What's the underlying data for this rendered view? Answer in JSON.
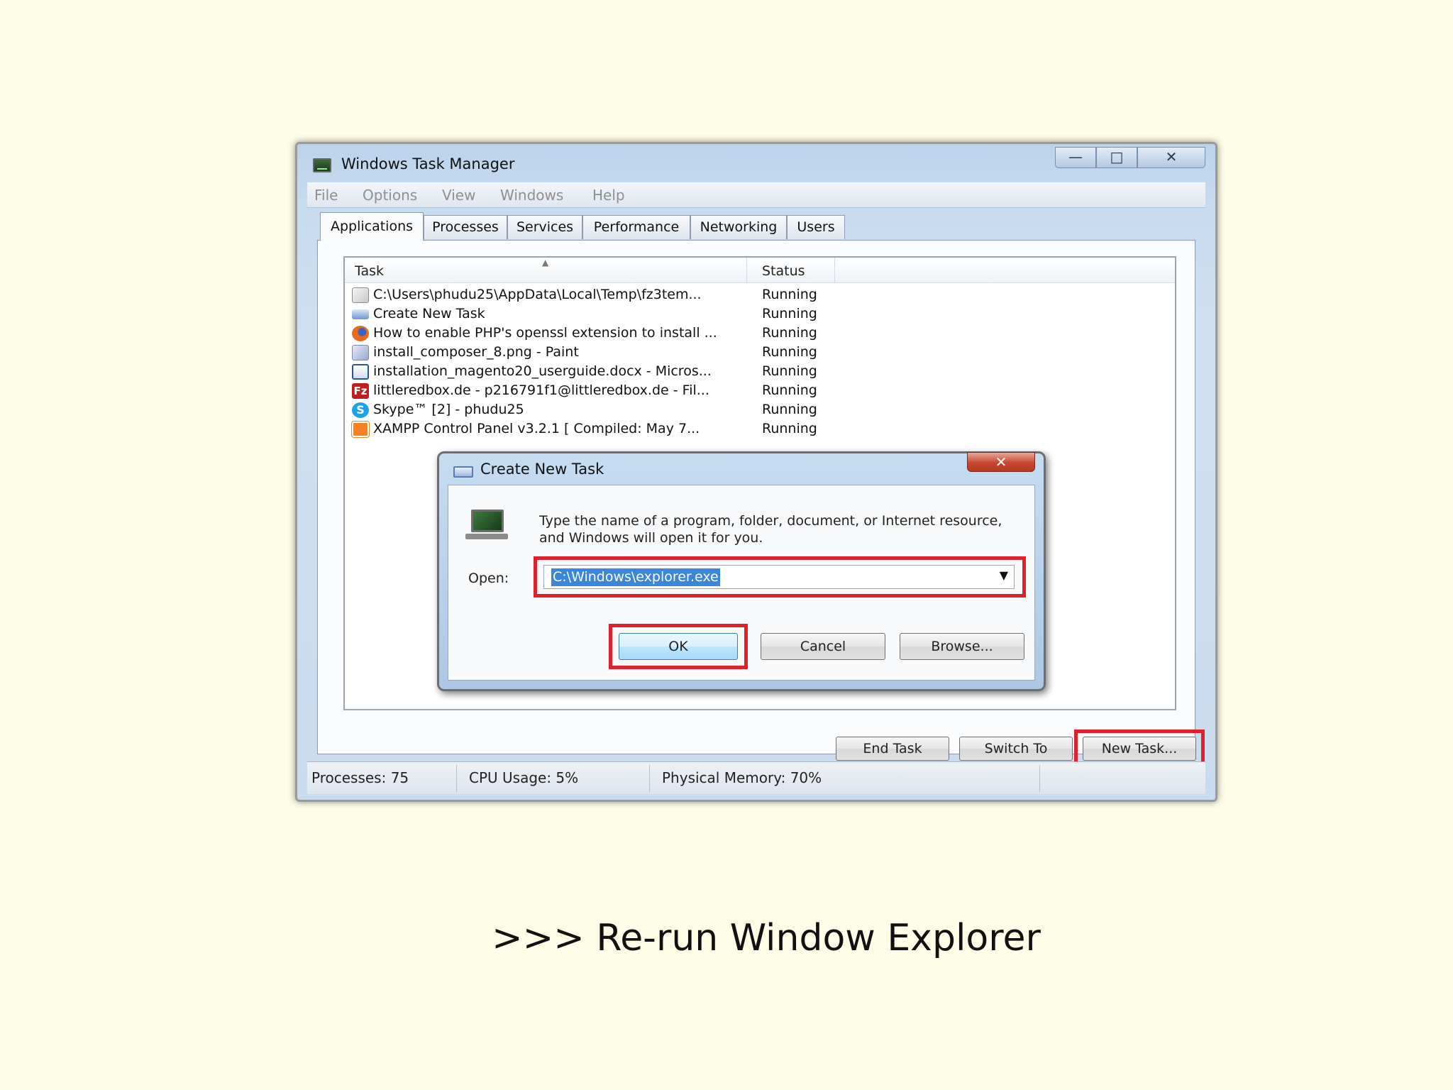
{
  "window": {
    "title": "Windows Task Manager",
    "controls": {
      "minimize": "—",
      "maximize": "□",
      "close": "✕"
    }
  },
  "menu": [
    "File",
    "Options",
    "View",
    "Windows",
    "Help"
  ],
  "tabs": [
    {
      "label": "Applications",
      "active": true
    },
    {
      "label": "Processes",
      "active": false
    },
    {
      "label": "Services",
      "active": false
    },
    {
      "label": "Performance",
      "active": false
    },
    {
      "label": "Networking",
      "active": false
    },
    {
      "label": "Users",
      "active": false
    }
  ],
  "task_list": {
    "columns": {
      "task": "Task",
      "status": "Status"
    },
    "rows": [
      {
        "name": "C:\\Users\\phudu25\\AppData\\Local\\Temp\\fz3tem...",
        "status": "Running",
        "icon": "notepad-icon"
      },
      {
        "name": "Create New Task",
        "status": "Running",
        "icon": "task-window-icon"
      },
      {
        "name": "How to enable PHP's openssl extension to install ...",
        "status": "Running",
        "icon": "firefox-icon"
      },
      {
        "name": "install_composer_8.png - Paint",
        "status": "Running",
        "icon": "paint-icon"
      },
      {
        "name": "installation_magento20_userguide.docx - Micros...",
        "status": "Running",
        "icon": "word-icon"
      },
      {
        "name": "littleredbox.de - p216791f1@littleredbox.de - Fil...",
        "status": "Running",
        "icon": "filezilla-icon"
      },
      {
        "name": "Skype™ [2] - phudu25",
        "status": "Running",
        "icon": "skype-icon"
      },
      {
        "name": "XAMPP Control Panel v3.2.1   [ Compiled: May 7...",
        "status": "Running",
        "icon": "xampp-icon"
      }
    ]
  },
  "buttons": {
    "end_task": "End Task",
    "switch_to": "Switch To",
    "new_task": "New Task..."
  },
  "statusbar": {
    "processes": "Processes: 75",
    "cpu": "CPU Usage: 5%",
    "memory": "Physical Memory: 70%"
  },
  "dialog": {
    "title": "Create New Task",
    "close": "✕",
    "instructions": "Type the name of a program, folder, document, or Internet resource, and Windows will open it for you.",
    "open_label": "Open:",
    "open_value": "C:\\Windows\\explorer.exe",
    "ok": "OK",
    "cancel": "Cancel",
    "browse": "Browse..."
  },
  "caption": ">>> Re-run Window Explorer",
  "colors": {
    "background": "#fdfde8",
    "highlight": "#e0202a",
    "selection": "#3b86d8"
  }
}
